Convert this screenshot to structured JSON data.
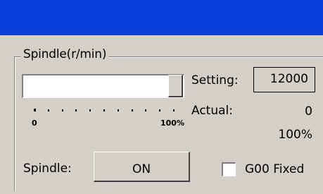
{
  "window": {
    "title_bar_color": "#0a3fdc"
  },
  "spindle_group": {
    "label": "Spindle(r/min)",
    "speed_slider": {
      "min_label": "0",
      "max_label": "100%",
      "value_percent": 100
    },
    "setting_label": "Setting:",
    "setting_value": "12000",
    "actual_label": "Actual:",
    "actual_value": "0",
    "override_percent": "100%",
    "spindle_label": "Spindle:",
    "spindle_button_label": "ON",
    "g00_fixed_label": "G00 Fixed",
    "g00_fixed_checked": false
  }
}
